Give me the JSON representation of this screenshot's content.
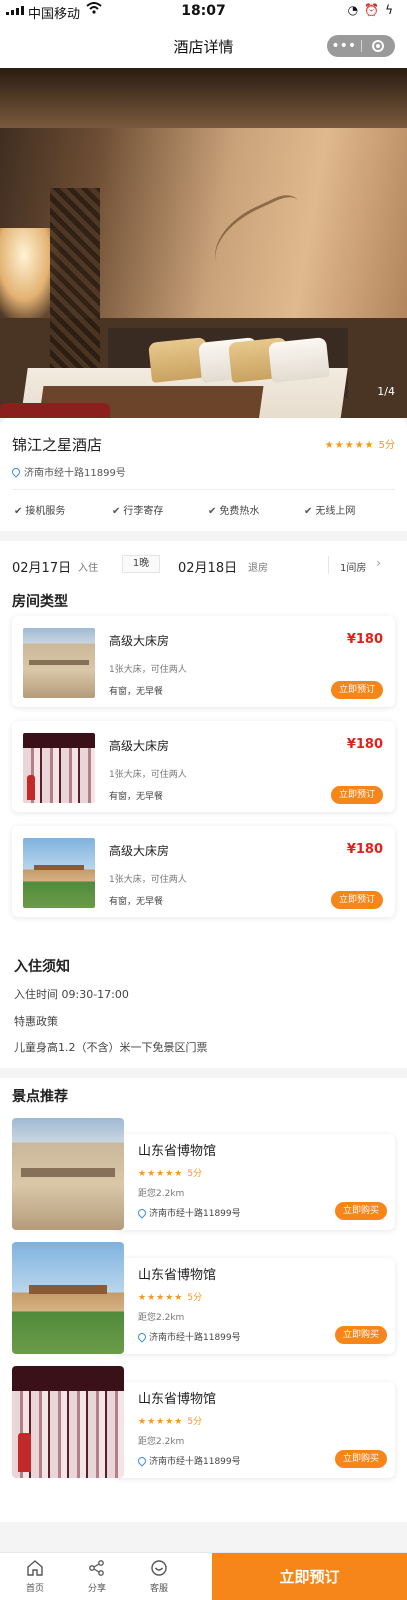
{
  "status_bar": {
    "carrier": "中国移动",
    "time": "18:07"
  },
  "nav": {
    "title": "酒店详情"
  },
  "hero": {
    "counter": "1/4"
  },
  "hotel": {
    "name": "锦江之星酒店",
    "stars": "★★★★★",
    "score": "5分",
    "address": "济南市经十路11899号",
    "amenities": [
      "接机服务",
      "行李寄存",
      "免费热水",
      "无线上网"
    ]
  },
  "booking": {
    "checkin_date": "02月17日",
    "checkin_label": "入住",
    "nights": "1晚",
    "checkout_date": "02月18日",
    "checkout_label": "退房",
    "rooms": "1间房"
  },
  "room_types": {
    "title": "房间类型",
    "items": [
      {
        "name": "高级大床房",
        "beds": "1张大床，可住两人",
        "window": "有窗，无早餐",
        "price": "¥180",
        "button": "立即预订",
        "image": "museum"
      },
      {
        "name": "高级大床房",
        "beds": "1张大床，可住两人",
        "window": "有窗，无早餐",
        "price": "¥180",
        "button": "立即预订",
        "image": "hall"
      },
      {
        "name": "高级大床房",
        "beds": "1张大床，可住两人",
        "window": "有窗，无早餐",
        "price": "¥180",
        "button": "立即预订",
        "image": "exterior"
      }
    ]
  },
  "notice": {
    "title": "入住须知",
    "checkin_time": "入住时间 09:30-17:00",
    "policy": "特惠政策",
    "child_policy": "儿童身高1.2（不含）米一下免景区门票"
  },
  "attractions": {
    "title": "景点推荐",
    "items": [
      {
        "name": "山东省博物馆",
        "stars": "★★★★★",
        "score": "5分",
        "distance": "距您2.2km",
        "address": "济南市经十路11899号",
        "button": "立即购买",
        "image": "museum"
      },
      {
        "name": "山东省博物馆",
        "stars": "★★★★★",
        "score": "5分",
        "distance": "距您2.2km",
        "address": "济南市经十路11899号",
        "button": "立即购买",
        "image": "exterior"
      },
      {
        "name": "山东省博物馆",
        "stars": "★★★★★",
        "score": "5分",
        "distance": "距您2.2km",
        "address": "济南市经十路11899号",
        "button": "立即购买",
        "image": "hall"
      }
    ]
  },
  "tabbar": {
    "home": "首页",
    "share": "分享",
    "service": "客服",
    "book": "立即预订"
  },
  "colors": {
    "accent": "#f7861a",
    "price": "#e0231a",
    "star": "#f39a1e"
  }
}
